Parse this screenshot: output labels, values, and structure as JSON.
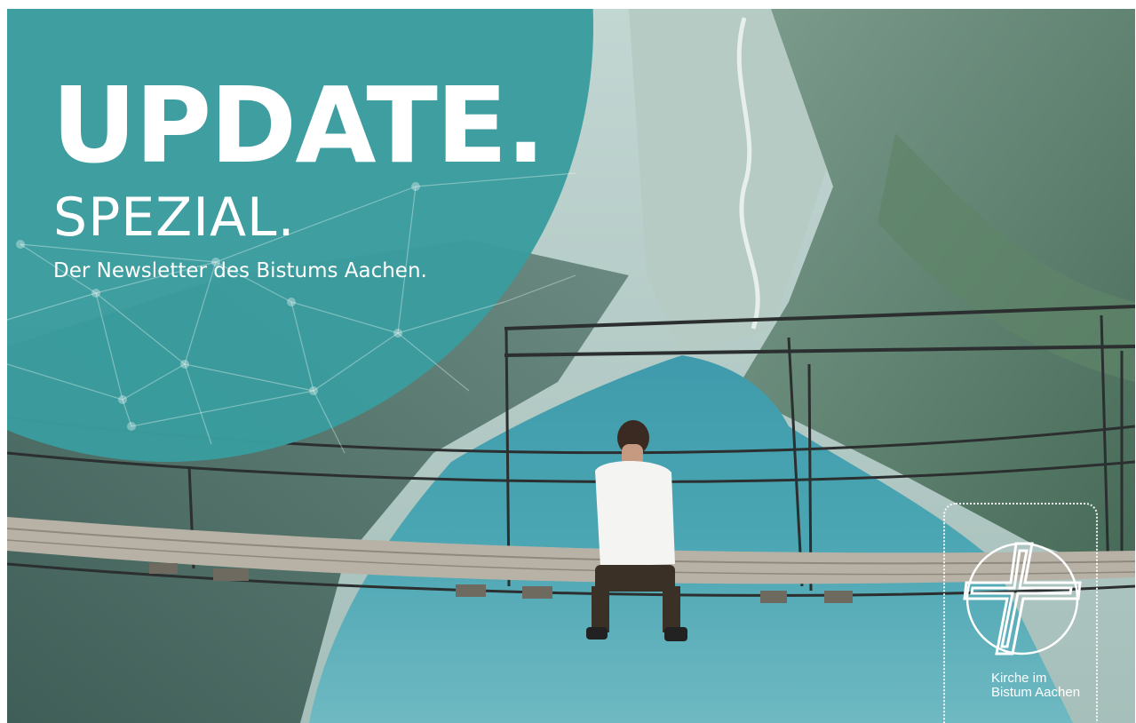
{
  "headline": {
    "main": "UPDATE.",
    "sub": "SPEZIAL.",
    "tagline": "Der Newsletter des Bistums Aachen."
  },
  "logo": {
    "line1": "Kirche im",
    "line2": "Bistum Aachen"
  },
  "colors": {
    "accent": "#3a9c9e",
    "text": "#ffffff"
  }
}
